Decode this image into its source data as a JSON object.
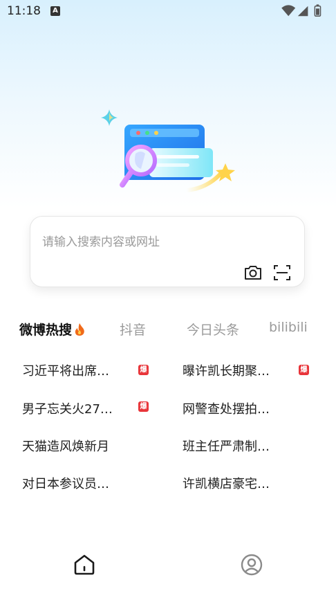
{
  "status": {
    "time": "11:18",
    "notification_glyph": "A"
  },
  "search": {
    "placeholder": "请输入搜索内容或网址"
  },
  "tabs": [
    {
      "label": "微博热搜",
      "active": true
    },
    {
      "label": "抖音",
      "active": false
    },
    {
      "label": "今日头条",
      "active": false
    },
    {
      "label": "bilibili",
      "active": false
    }
  ],
  "hot_list": [
    {
      "title": "习近平将出席…",
      "badge": "爆"
    },
    {
      "title": "曝许凯长期聚…",
      "badge": "爆"
    },
    {
      "title": "男子忘关火27…",
      "badge": "爆"
    },
    {
      "title": "网警查处摆拍…",
      "badge": ""
    },
    {
      "title": "天猫造风焕新月",
      "badge": ""
    },
    {
      "title": "班主任严肃制…",
      "badge": ""
    },
    {
      "title": "对日本参议员…",
      "badge": ""
    },
    {
      "title": "许凯横店豪宅…",
      "badge": ""
    }
  ],
  "nav": {
    "home_icon": "home-icon",
    "profile_icon": "user-icon"
  },
  "colors": {
    "accent": "#2f8dff",
    "hot_badge": "#e8353a",
    "fire": "#f06a1a"
  }
}
